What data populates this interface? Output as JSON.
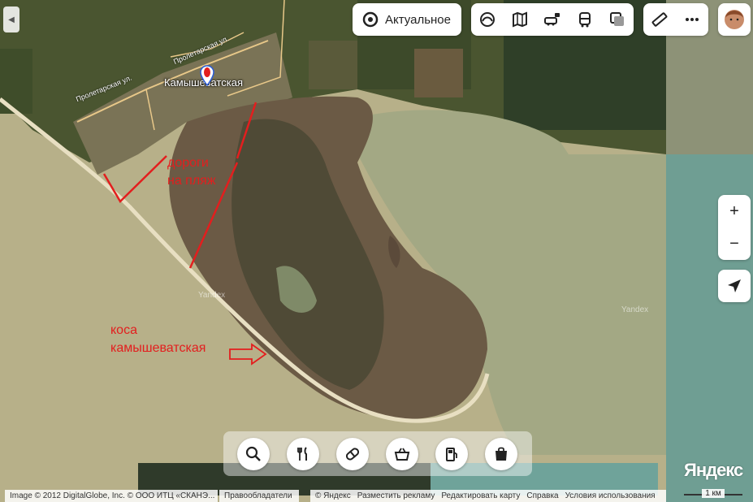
{
  "sidebar_toggle": {
    "icon": "chevron-left-icon"
  },
  "layers": {
    "label": "Актуальное",
    "icon": "target-icon"
  },
  "modes": [
    {
      "name": "panorama",
      "icon": "panorama-icon"
    },
    {
      "name": "map-type",
      "icon": "map-book-icon"
    },
    {
      "name": "traffic",
      "icon": "car-traffic-icon"
    },
    {
      "name": "transport",
      "icon": "bus-icon"
    },
    {
      "name": "layers",
      "icon": "layers-icon"
    }
  ],
  "tools": [
    {
      "name": "ruler",
      "icon": "ruler-icon"
    },
    {
      "name": "more",
      "icon": "more-dots-icon"
    }
  ],
  "zoom": {
    "in": "+",
    "out": "−"
  },
  "map": {
    "town": "Камышеватская",
    "streets": [
      "Пролетарская ул.",
      "Пролетарская ул."
    ],
    "annotation_roads": [
      "дороги",
      "на пляж"
    ],
    "annotation_spit": [
      "коса",
      "камышеватская"
    ],
    "watermark": "Yandex"
  },
  "categories": [
    {
      "name": "search",
      "icon": "search-icon"
    },
    {
      "name": "food",
      "icon": "fork-knife-icon"
    },
    {
      "name": "pharmacy",
      "icon": "pill-icon"
    },
    {
      "name": "grocery",
      "icon": "basket-icon"
    },
    {
      "name": "fuel",
      "icon": "fuel-icon"
    },
    {
      "name": "shopping",
      "icon": "shopping-bag-icon"
    }
  ],
  "footer": {
    "imagery": "Image © 2012 DigitalGlobe, Inc. © ООО ИТЦ «СКАНЭ...",
    "rightsholders": "Правообладатели",
    "links": [
      "© Яндекс",
      "Разместить рекламу",
      "Редактировать карту",
      "Справка",
      "Условия использования"
    ],
    "scale": "1 км",
    "logo": "Яндекс"
  },
  "colors": {
    "sea": "#a6ad86",
    "land": "#4f5a3a",
    "sand": "#e8dfc2",
    "annotation": "#e31e1e"
  }
}
